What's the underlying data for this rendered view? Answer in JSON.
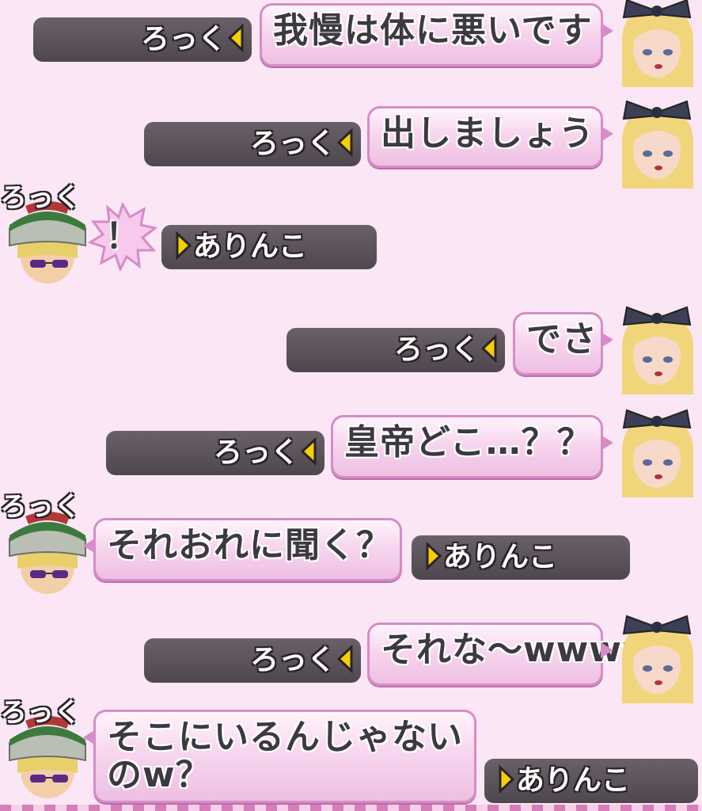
{
  "messages": [
    {
      "side": "right",
      "speaker": "ろっく",
      "text": "我慢は体に悪いです"
    },
    {
      "side": "right",
      "speaker": "ろっく",
      "text": "出しましょう"
    },
    {
      "side": "left",
      "speaker": "ありんこ",
      "speaker_label": "ろっく",
      "text": "！"
    },
    {
      "side": "right",
      "speaker": "ろっく",
      "text": "でさ"
    },
    {
      "side": "right",
      "speaker": "ろっく",
      "text": "皇帝どこ…？？"
    },
    {
      "side": "left",
      "speaker": "ありんこ",
      "speaker_label": "ろっく",
      "text": "それおれに聞く？"
    },
    {
      "side": "right",
      "speaker": "ろっく",
      "text": "それな〜wwww"
    },
    {
      "side": "left",
      "speaker": "ありんこ",
      "speaker_label": "ろっく",
      "text": "そこにいるんじゃないのw？"
    }
  ],
  "colors": {
    "background": "#fbe6f6",
    "bubble_border": "#d68cc6",
    "plate": "#5a5158",
    "arrow": "#f4d000"
  },
  "icons": {
    "right_avatar": "blonde-girl-bow-avatar",
    "left_avatar": "knit-hat-sunglasses-avatar",
    "name_arrow": "yellow-triangle-icon"
  }
}
